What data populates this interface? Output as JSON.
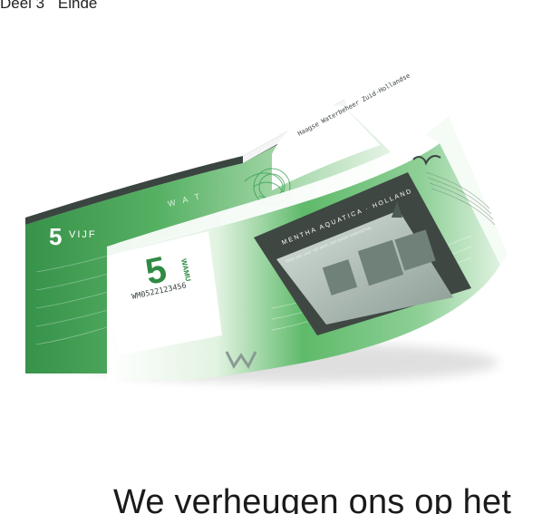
{
  "header": {
    "part": "Deel 3",
    "end": "Einde"
  },
  "banknote_back": {
    "value": "5",
    "value_word": "VIJF",
    "water_text": "W A T",
    "signature_block": "Haagse Waterbeheer Zuid-Hollandse"
  },
  "banknote_front": {
    "value": "5",
    "currency": "WAMU",
    "serial": "WM0522123456",
    "banner": "MENTHA AQUATICA · HOLLAND",
    "caption": "Blok van voor vijf werk, het mooie waterschap"
  },
  "headline": "We verheugen ons op het",
  "colors": {
    "green_dark": "#2f8a43",
    "green_mid": "#49a857",
    "green_light": "#c7e7c8",
    "grey_dark": "#3f4743"
  }
}
